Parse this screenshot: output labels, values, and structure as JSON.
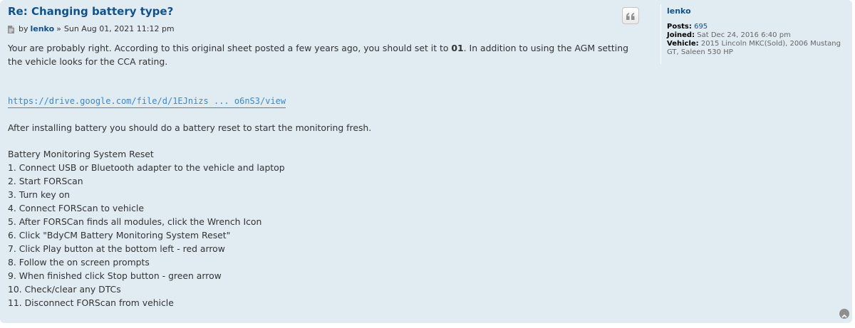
{
  "post": {
    "title": "Re: Changing battery type?",
    "by": "by",
    "author": "lenko",
    "separator": "»",
    "date": "Sun Aug 01, 2021 11:12 pm",
    "para1_before": "Your are probably right. According to this original sheet posted a few years ago, you should set it to ",
    "para1_bold": "01",
    "para1_after": ". In addition to using the AGM setting the vehicle looks for the CCA rating.",
    "link_text": "https://drive.google.com/file/d/1EJnizs ... o6nS3/view",
    "para2": "After installing battery you should do a battery reset to start the monitoring fresh.",
    "steps": [
      "Battery Monitoring System Reset",
      "1. Connect USB or Bluetooth adapter to the vehicle and laptop",
      "2. Start FORScan",
      "3. Turn key on",
      "4. Connect FORScan to vehicle",
      "5. After FORSCan finds all modules, click the Wrench Icon",
      "6. Click \"BdyCM Battery Monitoring System Reset\"",
      "7. Click Play button at the bottom left - red arrow",
      "8. Follow the on screen prompts",
      "9. When finished click Stop button - green arrow",
      "10. Check/clear any DTCs",
      "11. Disconnect FORScan from vehicle"
    ]
  },
  "profile": {
    "username": "lenko",
    "posts_label": "Posts:",
    "posts_value": "695",
    "joined_label": "Joined:",
    "joined_value": "Sat Dec 24, 2016 6:40 pm",
    "vehicle_label": "Vehicle:",
    "vehicle_value": "2015 Lincoln MKC(Sold), 2006 Mustang GT, Saleen 530 HP"
  },
  "icons": {
    "quote": "quote-icon",
    "post": "post-document-icon",
    "top": "back-to-top-icon"
  },
  "colors": {
    "post_bg": "#e1ebf2",
    "title": "#105289",
    "link": "#368ad2",
    "text": "#333333"
  }
}
